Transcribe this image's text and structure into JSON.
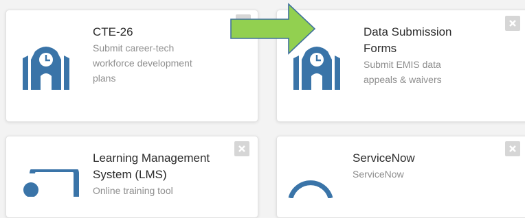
{
  "colors": {
    "icon_blue": "#3a74a8",
    "arrow_green": "#92d050",
    "arrow_outline": "#41719c",
    "close_bg": "#d6d6d6"
  },
  "tiles": [
    {
      "title": "CTE-26",
      "description_lines": [
        "Submit career-tech",
        "workforce development",
        "plans"
      ],
      "icon": "school-building-icon"
    },
    {
      "title_lines": [
        "Data Submission",
        "Forms"
      ],
      "description_lines": [
        "Submit EMIS data",
        "appeals & waivers"
      ],
      "icon": "school-building-icon"
    },
    {
      "title_lines": [
        "Learning Management",
        "System (LMS)"
      ],
      "description_lines": [
        "Online training tool"
      ],
      "icon": "presentation-board-icon"
    },
    {
      "title": "ServiceNow",
      "description_lines": [
        "ServiceNow"
      ],
      "icon": "service-desk-icon"
    }
  ],
  "annotation": {
    "icon": "green-arrow-icon"
  }
}
